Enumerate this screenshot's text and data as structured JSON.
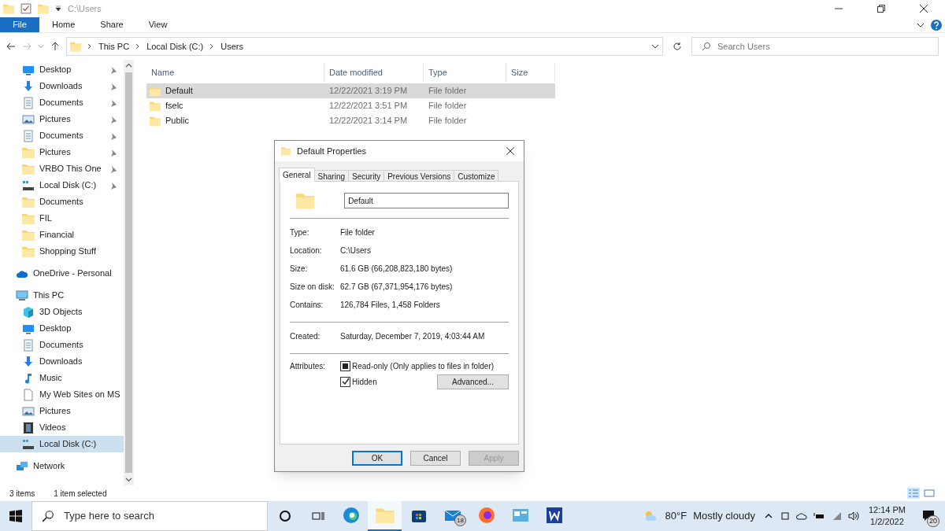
{
  "window": {
    "path": "C:\\Users"
  },
  "ribbon": {
    "file_tab": "File",
    "tabs": [
      "Home",
      "Share",
      "View"
    ]
  },
  "address_bar": {
    "crumbs": [
      "This PC",
      "Local Disk (C:)",
      "Users"
    ]
  },
  "search": {
    "placeholder": "Search Users"
  },
  "sidebar": {
    "items": [
      {
        "label": "Desktop",
        "kind": "desktop",
        "pinned": true,
        "selected": false
      },
      {
        "label": "Downloads",
        "kind": "download",
        "pinned": true,
        "selected": false
      },
      {
        "label": "Documents",
        "kind": "document",
        "pinned": true,
        "selected": false
      },
      {
        "label": "Pictures",
        "kind": "picture",
        "pinned": true,
        "selected": false
      },
      {
        "label": "Documents",
        "kind": "document",
        "pinned": true,
        "selected": false
      },
      {
        "label": "Pictures",
        "kind": "folder",
        "pinned": true,
        "selected": false
      },
      {
        "label": "VRBO This One",
        "kind": "folder",
        "pinned": true,
        "selected": false
      },
      {
        "label": "Local Disk (C:)",
        "kind": "drive",
        "pinned": true,
        "selected": false
      },
      {
        "label": "Documents",
        "kind": "folder",
        "pinned": false,
        "selected": false
      },
      {
        "label": "FIL",
        "kind": "folder",
        "pinned": false,
        "selected": false
      },
      {
        "label": "Financial",
        "kind": "folder",
        "pinned": false,
        "selected": false
      },
      {
        "label": "Shopping Stuff",
        "kind": "folder",
        "pinned": false,
        "selected": false
      }
    ],
    "roots": [
      {
        "label": "OneDrive - Personal",
        "kind": "cloud",
        "selected": false
      },
      {
        "label": "This PC",
        "kind": "pc",
        "selected": false,
        "children": [
          {
            "label": "3D Objects",
            "kind": "cube",
            "selected": false
          },
          {
            "label": "Desktop",
            "kind": "desktop",
            "selected": false
          },
          {
            "label": "Documents",
            "kind": "document",
            "selected": false
          },
          {
            "label": "Downloads",
            "kind": "download",
            "selected": false
          },
          {
            "label": "Music",
            "kind": "music",
            "selected": false
          },
          {
            "label": "My Web Sites on MS",
            "kind": "file",
            "selected": false
          },
          {
            "label": "Pictures",
            "kind": "picture",
            "selected": false
          },
          {
            "label": "Videos",
            "kind": "video",
            "selected": false
          },
          {
            "label": "Local Disk (C:)",
            "kind": "drive",
            "selected": true
          }
        ]
      },
      {
        "label": "Network",
        "kind": "network",
        "selected": false
      }
    ]
  },
  "table": {
    "columns": [
      "Name",
      "Date modified",
      "Type",
      "Size"
    ],
    "rows": [
      {
        "name": "Default",
        "date": "12/22/2021 3:19 PM",
        "type": "File folder",
        "selected": true
      },
      {
        "name": "fselc",
        "date": "12/22/2021 3:51 PM",
        "type": "File folder",
        "selected": false
      },
      {
        "name": "Public",
        "date": "12/22/2021 3:14 PM",
        "type": "File folder",
        "selected": false
      }
    ]
  },
  "status_bar": {
    "count": "3 items",
    "selection": "1 item selected"
  },
  "dialog": {
    "title": "Default Properties",
    "tabs": [
      {
        "label": "General",
        "selected": true
      },
      {
        "label": "Sharing",
        "selected": false
      },
      {
        "label": "Security",
        "selected": false
      },
      {
        "label": "Previous Versions",
        "selected": false
      },
      {
        "label": "Customize",
        "selected": false
      }
    ],
    "name_value": "Default",
    "sections": [
      [
        {
          "label": "Type:",
          "value": "File folder"
        },
        {
          "label": "Location:",
          "value": "C:\\Users"
        },
        {
          "label": "Size:",
          "value": "61.6 GB (66,208,823,180 bytes)"
        },
        {
          "label": "Size on disk:",
          "value": "62.7 GB (67,371,954,176 bytes)"
        },
        {
          "label": "Contains:",
          "value": "126,784 Files, 1,458 Folders"
        }
      ],
      [
        {
          "label": "Created:",
          "value": "Saturday, December 7, 2019, 4:03:44 AM"
        }
      ]
    ],
    "attributes_label": "Attributes:",
    "attributes": [
      {
        "label": "Read-only (Only applies to files in folder)",
        "kind": "tristate",
        "checked": true
      },
      {
        "label": "Hidden",
        "kind": "standard",
        "checked": true
      }
    ],
    "advanced_button": "Advanced...",
    "buttons": [
      {
        "label": "OK",
        "default": true,
        "disabled": false
      },
      {
        "label": "Cancel",
        "default": false,
        "disabled": false
      },
      {
        "label": "Apply",
        "default": false,
        "disabled": true
      }
    ]
  },
  "taskbar": {
    "search_placeholder": "Type here to search",
    "apps": [
      {
        "kind": "edge",
        "active": false
      },
      {
        "kind": "explorer",
        "active": true
      },
      {
        "kind": "store",
        "active": false
      },
      {
        "kind": "mail",
        "active": false,
        "badge": "18"
      },
      {
        "kind": "firefox",
        "active": false
      },
      {
        "kind": "app",
        "active": false
      },
      {
        "kind": "word",
        "active": false
      }
    ],
    "temperature": "80°F",
    "weather": "Mostly cloudy",
    "time": "12:14 PM",
    "date": "1/2/2022",
    "notifications": "20"
  }
}
